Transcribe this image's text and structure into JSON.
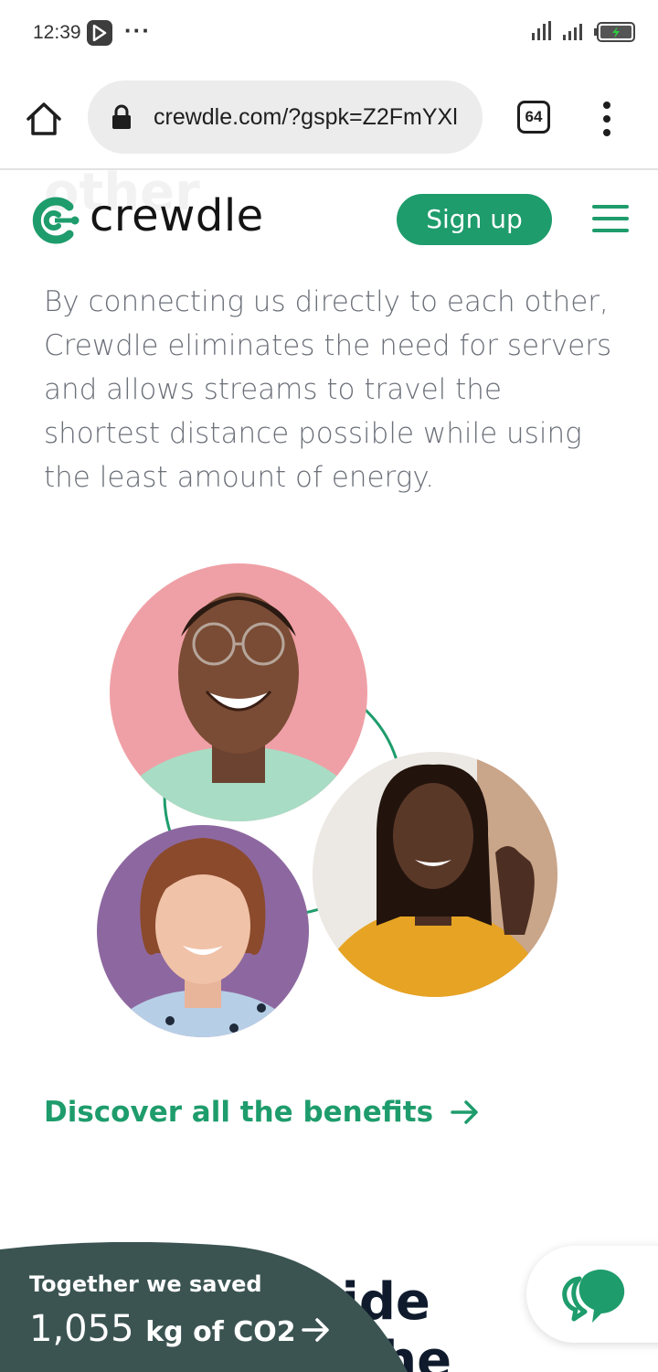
{
  "status_bar": {
    "time": "12:39",
    "play_icon": "media-play-icon",
    "dots": "···",
    "signal_icon": "cell-signal-icon",
    "battery_icon": "battery-charging-icon"
  },
  "browser": {
    "url": "crewdle.com/?gspk=Z2FmYXl",
    "tab_count": "64",
    "home_icon": "home-icon",
    "lock_icon": "lock-icon",
    "menu_icon": "kebab-menu-icon"
  },
  "header": {
    "ghost_text": "other",
    "logo_text": "crewdle",
    "signup_label": "Sign up",
    "menu_icon": "hamburger-icon",
    "accent_color": "#1e9c6c"
  },
  "main": {
    "intro_text": "By connecting us directly to each other, Crewdle eliminates the need for servers and allows streams to travel the shortest distance possible while using the least amount of energy.",
    "discover_label": "Discover all the benefits",
    "partial_heading_line1": "r vide",
    "partial_heading_line2": "ng the"
  },
  "co2_banner": {
    "label": "Together we saved",
    "amount": "1,055",
    "unit": "kg of CO2",
    "bg_color": "#3b5452"
  },
  "chat": {
    "icon": "chat-bubbles-icon"
  }
}
